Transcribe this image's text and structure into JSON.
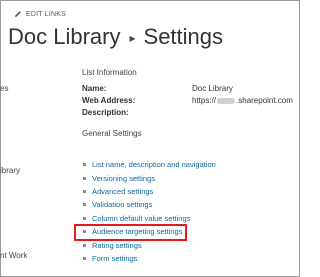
{
  "header": {
    "edit_links": "EDIT LINKS",
    "breadcrumb_root": "Doc Library",
    "breadcrumb_separator": "▸",
    "breadcrumb_current": "Settings"
  },
  "left_nav_fragments": [
    "es",
    "ibrary",
    "nt Work"
  ],
  "list_information": {
    "heading": "List Information",
    "name_label": "Name:",
    "name_value": "Doc Library",
    "address_label": "Web Address:",
    "address_prefix": "https://",
    "address_suffix": ".sharepoint.com",
    "description_label": "Description:"
  },
  "general_settings": {
    "heading": "General Settings",
    "items": [
      "List name, description and navigation",
      "Versioning settings",
      "Advanced settings",
      "Validation settings",
      "Column default value settings",
      "Audience targeting settings",
      "Rating settings",
      "Form settings"
    ],
    "highlighted_item": "Audience targeting settings"
  },
  "colors": {
    "link": "#0a6aa1",
    "highlight_box": "#e21c1c",
    "text": "#333333"
  }
}
